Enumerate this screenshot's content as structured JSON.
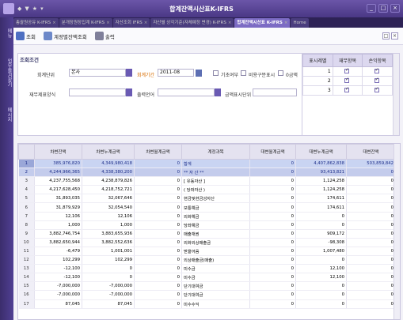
{
  "titlebar": {
    "controls": [
      "◆",
      "▼",
      "★",
      "▾"
    ],
    "title": "합계잔액시산표K-IFRS"
  },
  "tabs": [
    {
      "label": "총괄원공유 K-IFRS",
      "active": false
    },
    {
      "label": "분개장원장집계 K-IFRS",
      "active": false
    },
    {
      "label": "자산조회 IFRS",
      "active": false
    },
    {
      "label": "자산별 상각기준(자체예정 변경) K-IFRS",
      "active": false
    },
    {
      "label": "합계잔액시산표 K-IFRS",
      "active": true
    },
    {
      "label": "Home",
      "active": false
    }
  ],
  "sidebar": {
    "items": [
      "메뉴",
      "업무즐겨찾기",
      "메시지"
    ]
  },
  "toolbar": {
    "search": "조회",
    "account_search": "계정별잔액조회",
    "print": "출력",
    "win_btns": [
      "□",
      "×"
    ]
  },
  "conditions": {
    "section_title": "조회조건",
    "accounting_unit_label": "회계단위",
    "accounting_unit_value": "본사",
    "accounting_period_label": "회계기간",
    "accounting_period_value": "2011-08",
    "base_settle_label": "기초여부",
    "nondeduct_label": "비용구분표시",
    "zero_amount_label": "0금액",
    "financial_type_label": "재무제표양식",
    "financial_type_value": "",
    "output_lang_label": "출력언어",
    "output_lang_value": "",
    "currency_unit_label": "금액표시단위",
    "currency_unit_value": ""
  },
  "mini_grid": {
    "headers": [
      "표시레벨",
      "재무항목",
      "손익항목"
    ],
    "rows": [
      {
        "level": "1",
        "fin": true,
        "pl": true
      },
      {
        "level": "2",
        "fin": true,
        "pl": true
      },
      {
        "level": "3",
        "fin": true,
        "pl": true
      }
    ]
  },
  "grid": {
    "headers": [
      "",
      "차변잔액",
      "차변누계금액",
      "차변월계금액",
      "계정과목",
      "대변월계금액",
      "대변누계금액",
      "대변잔액"
    ],
    "rows": [
      {
        "no": "1",
        "debit_bal": "385,976,820",
        "debit_cum": "4,349,980,418",
        "debit_mon": "0",
        "account": "합계",
        "credit_mon": "0",
        "credit_cum": "4,407,862,838",
        "credit_bal": "503,859,842",
        "style": "hl"
      },
      {
        "no": "2",
        "debit_bal": "4,244,966,365",
        "debit_cum": "4,338,380,200",
        "debit_mon": "0",
        "account": "** 자  산 **",
        "credit_mon": "0",
        "credit_cum": "93,413,821",
        "credit_bal": "0",
        "style": "hl2"
      },
      {
        "no": "3",
        "debit_bal": "4,237,755,568",
        "debit_cum": "4,238,879,826",
        "debit_mon": "0",
        "account": "[ 유동자산 ]",
        "credit_mon": "0",
        "credit_cum": "1,124,258",
        "credit_bal": "0",
        "style": ""
      },
      {
        "no": "4",
        "debit_bal": "4,217,628,450",
        "debit_cum": "4,218,752,721",
        "debit_mon": "0",
        "account": "( 당좌자산 )",
        "credit_mon": "0",
        "credit_cum": "1,124,258",
        "credit_bal": "0",
        "style": ""
      },
      {
        "no": "5",
        "debit_bal": "31,893,035",
        "debit_cum": "32,067,646",
        "debit_mon": "0",
        "account": "현금및현금성자산",
        "credit_mon": "0",
        "credit_cum": "174,611",
        "credit_bal": "0",
        "style": ""
      },
      {
        "no": "6",
        "debit_bal": "31,879,929",
        "debit_cum": "32,054,540",
        "debit_mon": "0",
        "account": "보통예금",
        "credit_mon": "0",
        "credit_cum": "174,611",
        "credit_bal": "0",
        "style": ""
      },
      {
        "no": "7",
        "debit_bal": "12,106",
        "debit_cum": "12,106",
        "debit_mon": "0",
        "account": "외화예금",
        "credit_mon": "0",
        "credit_cum": "0",
        "credit_bal": "0",
        "style": ""
      },
      {
        "no": "8",
        "debit_bal": "1,000",
        "debit_cum": "1,000",
        "debit_mon": "0",
        "account": "당좌예금",
        "credit_mon": "0",
        "credit_cum": "0",
        "credit_bal": "0",
        "style": ""
      },
      {
        "no": "9",
        "debit_bal": "3,882,746,754",
        "debit_cum": "3,883,655,936",
        "debit_mon": "0",
        "account": "매출채권",
        "credit_mon": "0",
        "credit_cum": "909,172",
        "credit_bal": "0",
        "style": ""
      },
      {
        "no": "10",
        "debit_bal": "3,882,650,944",
        "debit_cum": "3,882,552,636",
        "debit_mon": "0",
        "account": "외화외상매출금",
        "credit_mon": "0",
        "credit_cum": "-98,308",
        "credit_bal": "0",
        "style": ""
      },
      {
        "no": "11",
        "debit_bal": "-6,479",
        "debit_cum": "1,001,001",
        "debit_mon": "0",
        "account": "받을어음",
        "credit_mon": "0",
        "credit_cum": "1,007,480",
        "credit_bal": "0",
        "style": ""
      },
      {
        "no": "12",
        "debit_bal": "102,299",
        "debit_cum": "102,299",
        "debit_mon": "0",
        "account": "외상매출금(매출)",
        "credit_mon": "0",
        "credit_cum": "0",
        "credit_bal": "0",
        "style": ""
      },
      {
        "no": "13",
        "debit_bal": "-12,100",
        "debit_cum": "0",
        "debit_mon": "0",
        "account": "미수금",
        "credit_mon": "0",
        "credit_cum": "12,100",
        "credit_bal": "0",
        "style": ""
      },
      {
        "no": "14",
        "debit_bal": "-12,100",
        "debit_cum": "0",
        "debit_mon": "0",
        "account": "미수금",
        "credit_mon": "0",
        "credit_cum": "12,100",
        "credit_bal": "0",
        "style": ""
      },
      {
        "no": "15",
        "debit_bal": "-7,000,000",
        "debit_cum": "-7,000,000",
        "debit_mon": "0",
        "account": "단기대여금",
        "credit_mon": "0",
        "credit_cum": "0",
        "credit_bal": "0",
        "style": ""
      },
      {
        "no": "16",
        "debit_bal": "-7,000,000",
        "debit_cum": "-7,000,000",
        "debit_mon": "0",
        "account": "단기대여금",
        "credit_mon": "0",
        "credit_cum": "0",
        "credit_bal": "0",
        "style": ""
      },
      {
        "no": "17",
        "debit_bal": "87,045",
        "debit_cum": "87,045",
        "debit_mon": "0",
        "account": "미수수익",
        "credit_mon": "0",
        "credit_cum": "0",
        "credit_bal": "0",
        "style": ""
      }
    ]
  },
  "colors": {
    "accent": "#5b4896",
    "highlight": "#c9d4f2",
    "period_label": "#d86d00"
  }
}
